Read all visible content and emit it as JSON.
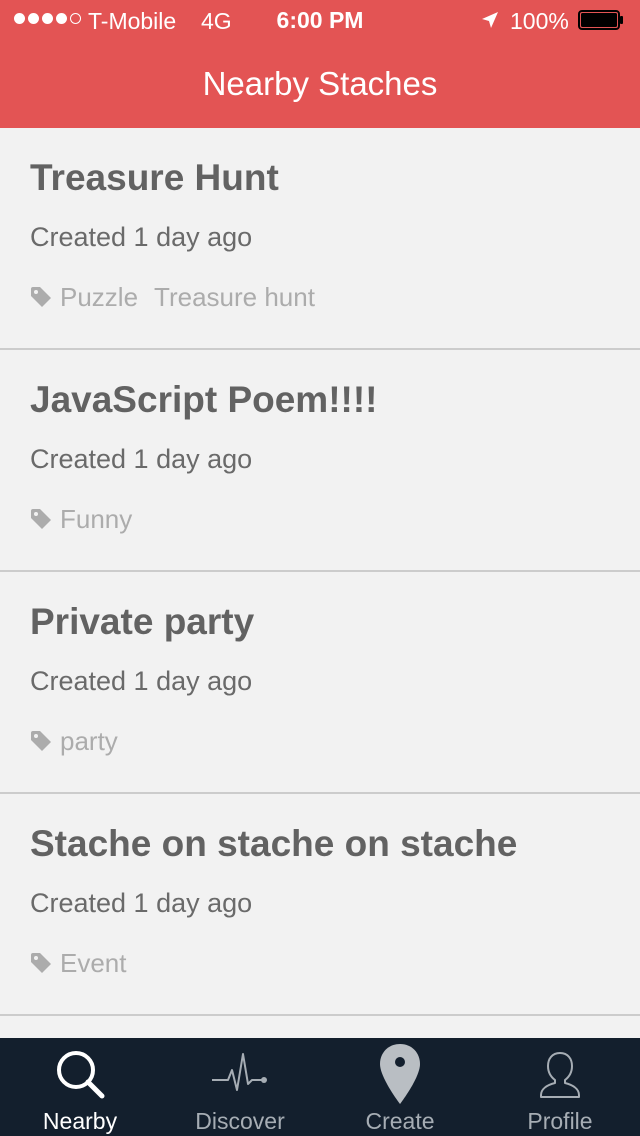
{
  "status_bar": {
    "carrier": "T-Mobile",
    "network": "4G",
    "time": "6:00 PM",
    "battery": "100%",
    "signal_icon": "signal-dots-icon",
    "location_icon": "location-arrow-icon",
    "battery_icon": "battery-icon"
  },
  "header": {
    "title": "Nearby Staches",
    "color": "#e35454"
  },
  "staches": [
    {
      "title": "Treasure Hunt",
      "subtitle": "Created 1 day ago",
      "tags": [
        "Puzzle",
        "Treasure hunt"
      ]
    },
    {
      "title": "JavaScript Poem!!!!",
      "subtitle": "Created 1 day ago",
      "tags": [
        "Funny"
      ]
    },
    {
      "title": "Private party",
      "subtitle": "Created 1 day ago",
      "tags": [
        "party"
      ]
    },
    {
      "title": "Stache on stache on stache",
      "subtitle": "Created 1 day ago",
      "tags": [
        "Event"
      ]
    }
  ],
  "tabbar": {
    "background": "#131f2d",
    "tabs": [
      {
        "label": "Nearby",
        "icon": "search-icon",
        "active": true
      },
      {
        "label": "Discover",
        "icon": "pulse-icon",
        "active": false
      },
      {
        "label": "Create",
        "icon": "map-pin-icon",
        "active": false
      },
      {
        "label": "Profile",
        "icon": "person-icon",
        "active": false
      }
    ]
  }
}
